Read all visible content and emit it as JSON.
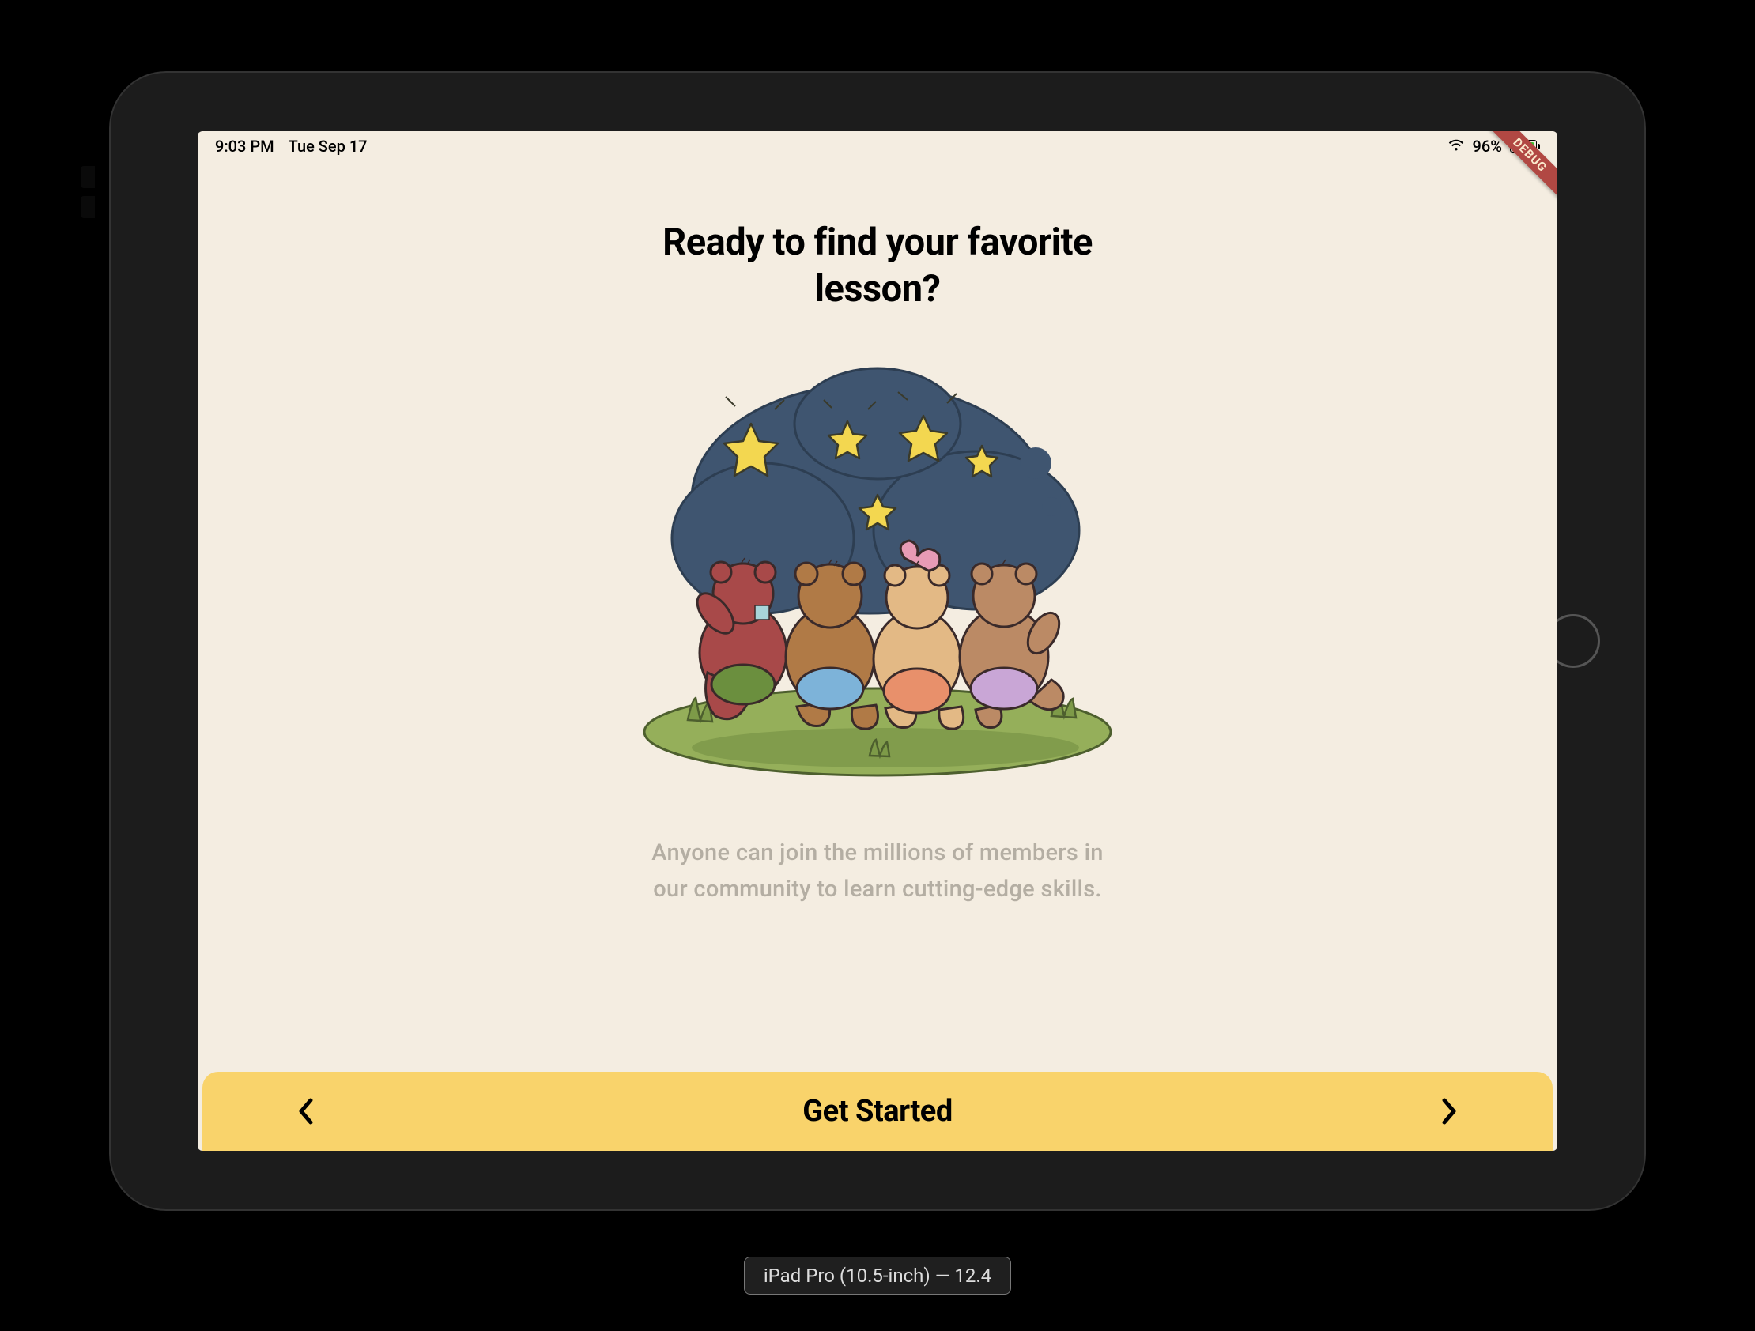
{
  "status": {
    "time": "9:03 PM",
    "date": "Tue Sep 17",
    "battery_percent": "96%"
  },
  "debug_banner": "DEBUG",
  "onboarding": {
    "heading": "Ready to find your favorite lesson?",
    "subheading": "Anyone can join the millions of members in our community to learn cutting-edge skills."
  },
  "bottom_bar": {
    "cta": "Get Started"
  },
  "device_label": "iPad Pro (10.5-inch) — 12.4",
  "illustration": {
    "description": "teddy-bears-watching-stars",
    "colors": {
      "sky": "#3f5570",
      "sky_light": "#5a7290",
      "star": "#f3d750",
      "star_stroke": "#3a3a2a",
      "grass": "#95af5a",
      "grass_dark": "#6e8a3e",
      "bear1": "#a84949",
      "bear2": "#b07a46",
      "bear3": "#e3b985",
      "bear4": "#bb8a65",
      "shirt1": "#6b8f3e",
      "shirt2": "#7db3d9",
      "shirt3": "#e8906b",
      "shirt4": "#c9a6d6",
      "bow": "#e89bb5"
    }
  }
}
